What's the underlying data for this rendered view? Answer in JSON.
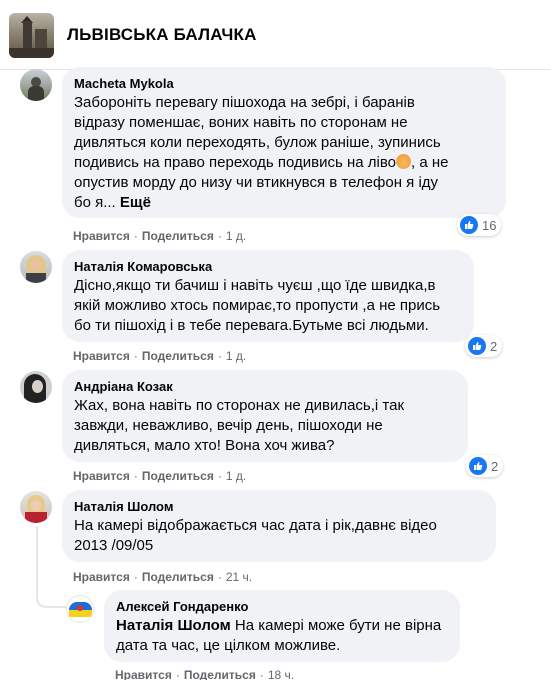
{
  "group": {
    "name": "ЛЬВІВСЬКА БАЛАЧКА"
  },
  "comments": [
    {
      "author": "Macheta Mykola",
      "lines": [
        "Заборонiть перевагу пішохода на зебрі, і баранів",
        "відразу поменшає, воних навіть по сторонам не",
        "дивляться коли переходять, булож раніше, зупинись",
        "подивись на право переходь подивись на ліво",
        "опустив морду до низу чи втикнувся в телефон я іду",
        "бо я... "
      ],
      "line4_tail": ", а не",
      "more": "Ещё",
      "like": "Нравится",
      "reply": "Поделиться",
      "time": "1 д.",
      "reactions": "16"
    },
    {
      "author": "Наталія Комаровська",
      "lines": [
        "Дісно,якщо ти бачиш і навіть чуєш ,що їде швидка,в",
        "якій можливо хтось помирає,то пропусти ,а не прись",
        "бо ти пішохід і в тебе перевага.Бутьме всі людьми."
      ],
      "like": "Нравится",
      "reply": "Поделиться",
      "time": "1 д.",
      "reactions": "2"
    },
    {
      "author": "Андріана Козак",
      "lines": [
        "Жах, вона навіть по сторонах не дивилась,і так",
        "завжди, неважливо, вечір день, пішоходи не",
        "дивляться, мало хто! Вона хоч жива?"
      ],
      "like": "Нравится",
      "reply": "Поделиться",
      "time": "1 д.",
      "reactions": "2"
    },
    {
      "author": "Наталія Шолом",
      "lines": [
        "На камері відображається час дата і рік,давнє відео",
        "2013 /09/05"
      ],
      "like": "Нравится",
      "reply": "Поделиться",
      "time": "21 ч."
    }
  ],
  "reply": {
    "author": "Алексей Гондаренко",
    "mention": "Наталія Шолом",
    "line1_rest": " На камері може бути не вірна",
    "line2": "дата та час, це цілком можливе.",
    "like": "Нравится",
    "reply": "Поделиться",
    "time": "18 ч."
  },
  "colors": {
    "like_blue": "#1877f2",
    "bubble_bg": "#f0f2f5",
    "meta_gray": "#65676b"
  }
}
